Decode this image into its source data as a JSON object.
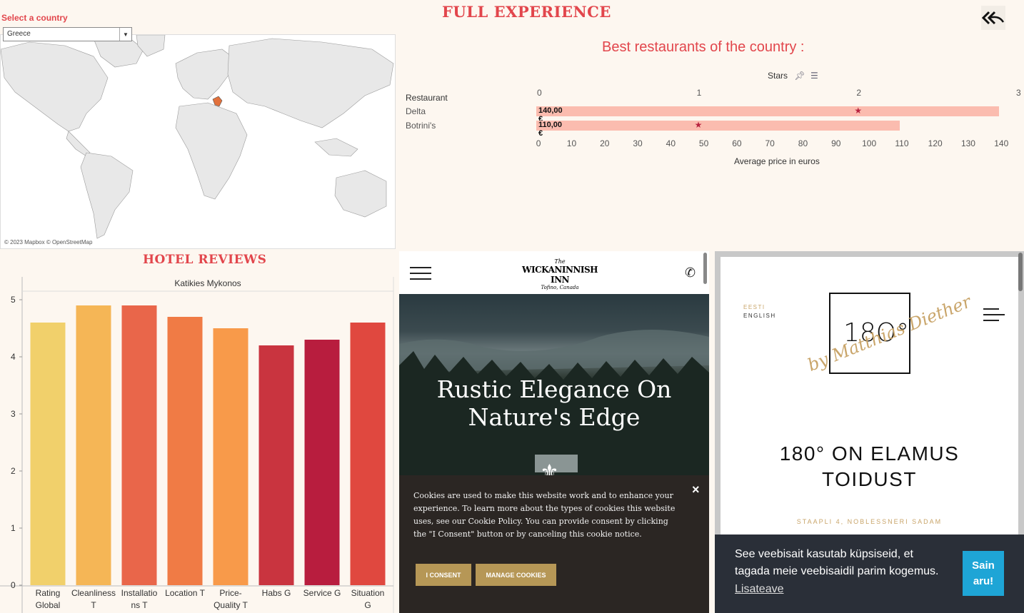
{
  "header": {
    "title": "FULL EXPERIENCE",
    "back_icon": "double-back-arrow-icon"
  },
  "country_filter": {
    "label": "Select a country",
    "selected": "Greece",
    "map_credit": "© 2023 Mapbox © OpenStreetMap"
  },
  "restaurants": {
    "title": "Best restaurants of the country :",
    "stars_header": "Stars",
    "column_header": "Restaurant",
    "star_ticks": [
      "0",
      "1",
      "2",
      "3"
    ],
    "price_ticks": [
      "0",
      "10",
      "20",
      "30",
      "40",
      "50",
      "60",
      "70",
      "80",
      "90",
      "100",
      "110",
      "120",
      "130",
      "140"
    ],
    "xlabel": "Average price in euros",
    "rows": [
      {
        "name": "Delta",
        "price_label": "140,00 €",
        "price": 140,
        "stars": 2
      },
      {
        "name": "Botrini's",
        "price_label": "110,00 €",
        "price": 110,
        "stars": 1
      }
    ]
  },
  "hotel_reviews": {
    "title": "HOTEL REVIEWS"
  },
  "chart_data": {
    "type": "bar",
    "title": "Katikies Mykonos",
    "categories": [
      "Rating Global",
      "Cleanliness T",
      "Installations T",
      "Location T",
      "Price-Quality T",
      "Habs G",
      "Service G",
      "Situation G"
    ],
    "category_labels": [
      [
        "Rating",
        "Global"
      ],
      [
        "Cleanliness",
        "T"
      ],
      [
        "Installatio",
        "ns T"
      ],
      [
        "Location T"
      ],
      [
        "Price-",
        "Quality T"
      ],
      [
        "Habs G"
      ],
      [
        "Service G"
      ],
      [
        "Situation",
        "G"
      ]
    ],
    "values": [
      4.6,
      4.9,
      4.9,
      4.7,
      4.5,
      4.2,
      4.3,
      4.6
    ],
    "colors": [
      "#f1d06b",
      "#f5b656",
      "#e9664a",
      "#f07b45",
      "#f89a4a",
      "#c9343f",
      "#b81d3e",
      "#e0483f"
    ],
    "ylim": [
      0,
      5
    ],
    "yticks": [
      "0",
      "1",
      "2",
      "3",
      "4",
      "5"
    ]
  },
  "wickaninnish": {
    "logo_top": "The",
    "logo_main": "WICKANINNISH INN",
    "logo_sub": "Tofino, Canada",
    "hero_title_line1": "Rustic Elegance On",
    "hero_title_line2": "Nature's Edge",
    "cookie_text": "Cookies are used to make this website work and to enhance your experience. To learn more about the types of cookies this website uses, see our Cookie Policy. You can provide consent by clicking the \"I Consent\" button or by canceling this cookie notice.",
    "consent_label": "I CONSENT",
    "manage_label": "MANAGE COOKIES",
    "close_label": "×"
  },
  "p180": {
    "lang_eesti": "EESTI",
    "lang_english": "ENGLISH",
    "logo": "18O°",
    "signature": "by Matthias Diether",
    "heading_line1": "180° ON ELAMUS",
    "heading_line2": "TOIDUST",
    "address": "STAAPLI 4, NOBLESSNERI SADAM",
    "cookie_text_line1": "See veebisait kasutab küpsiseid, et",
    "cookie_text_line2": "tagada meie veebisaidil parim kogemus.",
    "cookie_link": "Lisateave",
    "cookie_btn_line1": "Sain",
    "cookie_btn_line2": "aru!"
  }
}
